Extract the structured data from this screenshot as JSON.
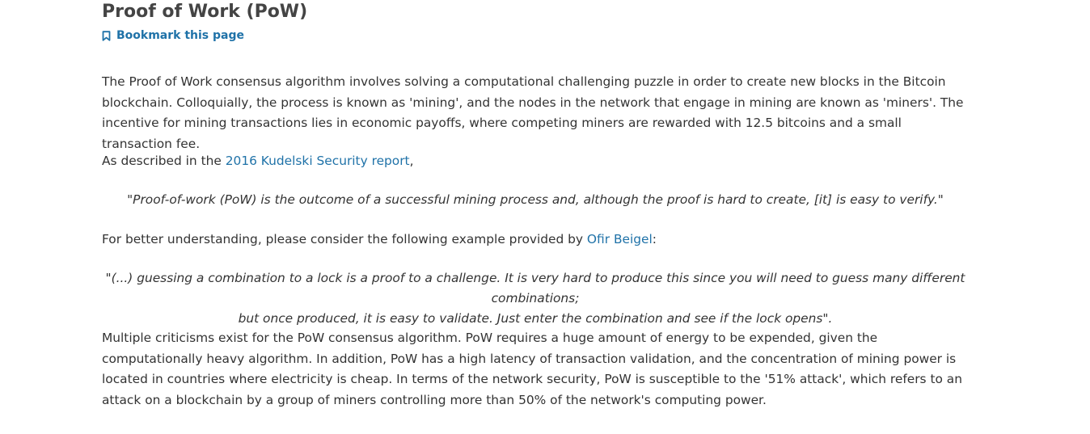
{
  "page": {
    "title": "Proof of Work (PoW)",
    "bookmark_label": "Bookmark this page"
  },
  "paragraph1": {
    "text": "The Proof of Work consensus algorithm involves solving a computational challenging puzzle in order to create new blocks in the Bitcoin blockchain. Colloquially, the process is known as 'mining', and the nodes in the network that engage in mining are known as 'miners'. The incentive for mining transactions lies in economic payoffs, where competing miners are rewarded with 12.5 bitcoins and a small transaction fee."
  },
  "paragraph2": {
    "before": "As described in the ",
    "link": "2016 Kudelski Security report",
    "after": ","
  },
  "quote1": {
    "text": "\"Proof-of-work (PoW) is the outcome of a successful mining process and, although the proof is hard to create, [it] is easy to verify.\""
  },
  "paragraph3": {
    "before": "For better understanding, please consider the following example provided by ",
    "link": "Ofir Beigel",
    "after": ":"
  },
  "quote2": {
    "line1": "\"(...) guessing a combination to a lock is a proof to a challenge. It is very hard to produce this since you will need to guess many different combinations;",
    "line2": "but once produced, it is easy to validate. Just enter the combination and see if the lock opens\"."
  },
  "paragraph4": {
    "text": "Multiple criticisms exist for the PoW consensus algorithm. PoW requires a huge amount of energy to be expended, given the computationally heavy algorithm. In addition, PoW has a high latency of transaction validation, and the concentration of mining power is located in countries where electricity is cheap. In terms of the network security, PoW is susceptible to the '51% attack', which refers to an attack on a blockchain by a group of miners controlling more than 50% of the network's computing power."
  },
  "colors": {
    "link": "#1f72a8",
    "text": "#333333",
    "title": "#444444"
  },
  "icons": {
    "bookmark": "bookmark-icon"
  }
}
